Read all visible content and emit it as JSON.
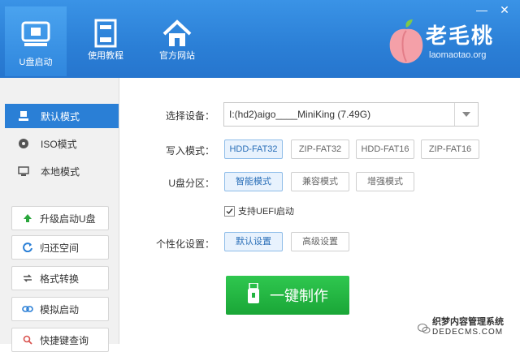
{
  "window_controls": {
    "minimize": "—",
    "close": "✕"
  },
  "nav": {
    "items": [
      {
        "label": "U盘启动",
        "icon": "usb-drive-icon"
      },
      {
        "label": "使用教程",
        "icon": "document-icon"
      },
      {
        "label": "官方网站",
        "icon": "home-icon"
      }
    ]
  },
  "logo": {
    "title": "老毛桃",
    "subtitle": "laomaotao.org"
  },
  "sidebar": {
    "modes": [
      {
        "label": "默认模式",
        "icon": "person-icon"
      },
      {
        "label": "ISO模式",
        "icon": "disc-icon"
      },
      {
        "label": "本地模式",
        "icon": "monitor-icon"
      }
    ],
    "actions": [
      {
        "label": "升级启动U盘",
        "icon": "arrow-up-icon"
      },
      {
        "label": "归还空间",
        "icon": "restore-icon"
      },
      {
        "label": "格式转换",
        "icon": "swap-icon"
      },
      {
        "label": "模拟启动",
        "icon": "link-icon"
      },
      {
        "label": "快捷键查询",
        "icon": "search-icon"
      }
    ]
  },
  "form": {
    "device_label": "选择设备：",
    "device_value": "I:(hd2)aigo____MiniKing (7.49G)",
    "write_mode_label": "写入模式：",
    "write_modes": [
      "HDD-FAT32",
      "ZIP-FAT32",
      "HDD-FAT16",
      "ZIP-FAT16"
    ],
    "partition_label": "U盘分区：",
    "partition_modes": [
      "智能模式",
      "兼容模式",
      "增强模式"
    ],
    "uefi_label": "支持UEFI启动",
    "personalize_label": "个性化设置：",
    "personalize_options": [
      "默认设置",
      "高级设置"
    ],
    "make_button": "一键制作"
  },
  "watermark": {
    "title": "织梦内容管理系统",
    "subtitle": "DEDECMS.COM"
  },
  "colors": {
    "header": "#2b7fd6",
    "accent": "#2a7fd6",
    "make_button": "#22b440"
  }
}
